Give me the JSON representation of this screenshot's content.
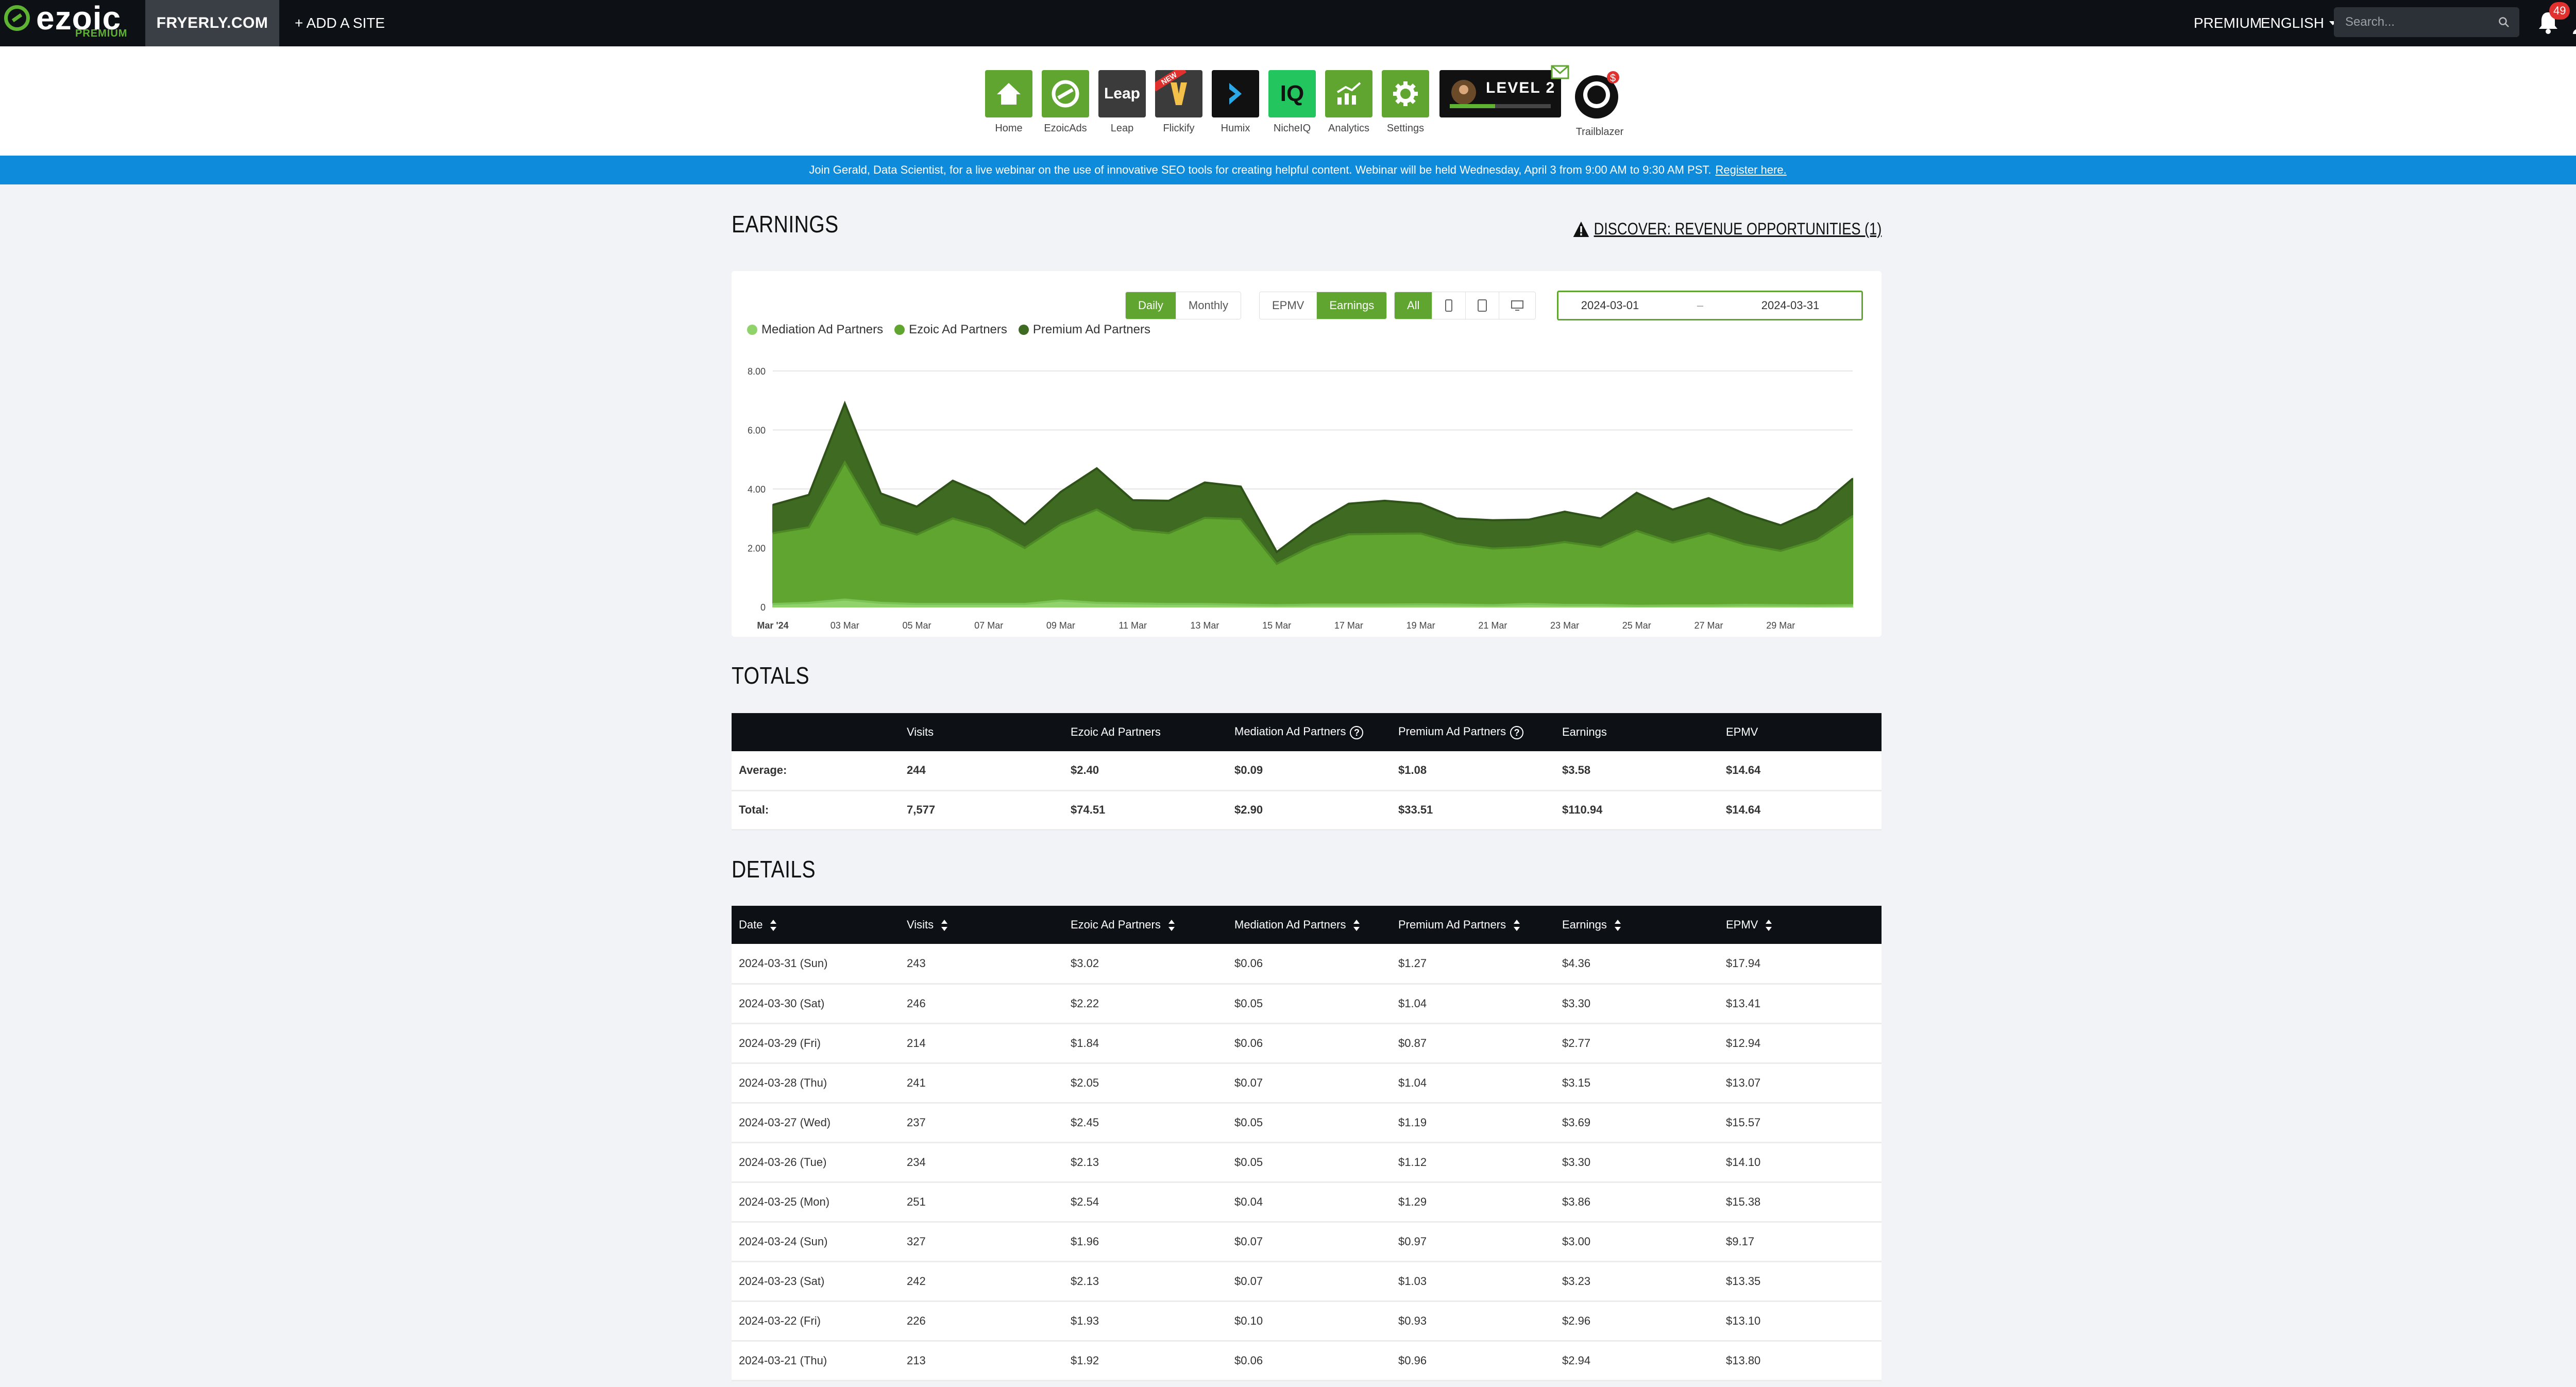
{
  "topbar": {
    "logo_word": "ezoic",
    "logo_sub": "PREMIUM",
    "site_name": "FRYERLY.COM",
    "add_site": "+ ADD A SITE",
    "premium": "PREMIUM",
    "language": "ENGLISH",
    "search_placeholder": "Search...",
    "notification_count": "49"
  },
  "apps": [
    {
      "label": "Home",
      "icon": "home-icon",
      "color": "#5fa530"
    },
    {
      "label": "EzoicAds",
      "icon": "ezoicads-icon",
      "color": "#5fa530"
    },
    {
      "label": "Leap",
      "icon": "leap-icon",
      "color": "#3b3b3b",
      "text": "Leap"
    },
    {
      "label": "Flickify",
      "icon": "flickify-icon",
      "color": "#3b3b3b",
      "badge": "NEW"
    },
    {
      "label": "Humix",
      "icon": "humix-icon",
      "color": "#111111"
    },
    {
      "label": "NicheIQ",
      "icon": "nicheiq-icon",
      "color": "#22c55e",
      "text": "IQ"
    },
    {
      "label": "Analytics",
      "icon": "analytics-icon",
      "color": "#5fa530"
    },
    {
      "label": "Settings",
      "icon": "settings-icon",
      "color": "#5fa530"
    }
  ],
  "level": {
    "text": "LEVEL 2",
    "progress": 0.45
  },
  "trailblazer": {
    "label": "Trailblazer"
  },
  "banner": {
    "text": "Join Gerald, Data Scientist, for a live webinar on the use of innovative SEO tools for creating helpful content. Webinar will be held Wednesday, April 3 from 9:00 AM to 9:30 AM PST.",
    "link": "Register here."
  },
  "earnings": {
    "title": "EARNINGS",
    "discover": "DISCOVER: REVENUE OPPORTUNITIES (1)",
    "period_buttons": [
      "Daily",
      "Monthly"
    ],
    "metric_buttons": [
      "EPMV",
      "Earnings"
    ],
    "device_all": "All",
    "date_from": "2024-03-01",
    "date_sep": "–",
    "date_to": "2024-03-31"
  },
  "colors": {
    "accent": "#5fa530",
    "mediation": "#8fd36a",
    "ezoic": "#5fa530",
    "premium": "#3e6b21",
    "topbar": "#0d1116",
    "banner": "#0f8bdb"
  },
  "chart_data": {
    "type": "area",
    "stacked": true,
    "x": [
      "2024-03-01",
      "2024-03-02",
      "2024-03-03",
      "2024-03-04",
      "2024-03-05",
      "2024-03-06",
      "2024-03-07",
      "2024-03-08",
      "2024-03-09",
      "2024-03-10",
      "2024-03-11",
      "2024-03-12",
      "2024-03-13",
      "2024-03-14",
      "2024-03-15",
      "2024-03-16",
      "2024-03-17",
      "2024-03-18",
      "2024-03-19",
      "2024-03-20",
      "2024-03-21",
      "2024-03-22",
      "2024-03-23",
      "2024-03-24",
      "2024-03-25",
      "2024-03-26",
      "2024-03-27",
      "2024-03-28",
      "2024-03-29",
      "2024-03-30",
      "2024-03-31"
    ],
    "x_tick_labels": [
      "Mar '24",
      "03 Mar",
      "05 Mar",
      "07 Mar",
      "09 Mar",
      "11 Mar",
      "13 Mar",
      "15 Mar",
      "17 Mar",
      "19 Mar",
      "21 Mar",
      "23 Mar",
      "25 Mar",
      "27 Mar",
      "29 Mar"
    ],
    "y_ticks": [
      "0",
      "2.00",
      "4.00",
      "6.00",
      "8.00"
    ],
    "ylim": [
      0,
      8
    ],
    "legend_position": "top-left",
    "series": [
      {
        "name": "Mediation Ad Partners",
        "color": "#8fd36a",
        "values": [
          0.1,
          0.14,
          0.25,
          0.14,
          0.1,
          0.1,
          0.1,
          0.1,
          0.22,
          0.14,
          0.12,
          0.1,
          0.1,
          0.08,
          0.06,
          0.08,
          0.08,
          0.08,
          0.09,
          0.08,
          0.06,
          0.1,
          0.07,
          0.07,
          0.04,
          0.05,
          0.05,
          0.07,
          0.06,
          0.05,
          0.06
        ]
      },
      {
        "name": "Ezoic Ad Partners",
        "color": "#5fa530",
        "values": [
          2.4,
          2.56,
          4.65,
          2.66,
          2.35,
          2.9,
          2.55,
          1.9,
          2.58,
          3.16,
          2.5,
          2.4,
          2.92,
          2.9,
          1.4,
          2.0,
          2.38,
          2.4,
          2.4,
          2.06,
          1.92,
          1.93,
          2.13,
          1.96,
          2.54,
          2.13,
          2.45,
          2.05,
          1.84,
          2.22,
          3.02
        ]
      },
      {
        "name": "Premium Ad Partners",
        "color": "#3e6b21",
        "values": [
          0.96,
          1.1,
          2.0,
          1.05,
          0.95,
          1.28,
          1.1,
          0.8,
          1.1,
          1.4,
          1.0,
          1.1,
          1.2,
          1.1,
          0.4,
          0.7,
          1.04,
          1.12,
          1.01,
          0.86,
          0.96,
          0.93,
          1.03,
          0.97,
          1.29,
          1.12,
          1.19,
          1.04,
          0.87,
          1.04,
          1.27
        ]
      }
    ]
  },
  "totals": {
    "title": "TOTALS",
    "headers": [
      "",
      "Visits",
      "Ezoic Ad Partners",
      "Mediation Ad Partners",
      "Premium Ad Partners",
      "Earnings",
      "EPMV"
    ],
    "rows": [
      [
        "Average:",
        "244",
        "$2.40",
        "$0.09",
        "$1.08",
        "$3.58",
        "$14.64"
      ],
      [
        "Total:",
        "7,577",
        "$74.51",
        "$2.90",
        "$33.51",
        "$110.94",
        "$14.64"
      ]
    ]
  },
  "details": {
    "title": "DETAILS",
    "headers": [
      "Date",
      "Visits",
      "Ezoic Ad Partners",
      "Mediation Ad Partners",
      "Premium Ad Partners",
      "Earnings",
      "EPMV"
    ],
    "rows": [
      [
        "2024-03-31 (Sun)",
        "243",
        "$3.02",
        "$0.06",
        "$1.27",
        "$4.36",
        "$17.94"
      ],
      [
        "2024-03-30 (Sat)",
        "246",
        "$2.22",
        "$0.05",
        "$1.04",
        "$3.30",
        "$13.41"
      ],
      [
        "2024-03-29 (Fri)",
        "214",
        "$1.84",
        "$0.06",
        "$0.87",
        "$2.77",
        "$12.94"
      ],
      [
        "2024-03-28 (Thu)",
        "241",
        "$2.05",
        "$0.07",
        "$1.04",
        "$3.15",
        "$13.07"
      ],
      [
        "2024-03-27 (Wed)",
        "237",
        "$2.45",
        "$0.05",
        "$1.19",
        "$3.69",
        "$15.57"
      ],
      [
        "2024-03-26 (Tue)",
        "234",
        "$2.13",
        "$0.05",
        "$1.12",
        "$3.30",
        "$14.10"
      ],
      [
        "2024-03-25 (Mon)",
        "251",
        "$2.54",
        "$0.04",
        "$1.29",
        "$3.86",
        "$15.38"
      ],
      [
        "2024-03-24 (Sun)",
        "327",
        "$1.96",
        "$0.07",
        "$0.97",
        "$3.00",
        "$9.17"
      ],
      [
        "2024-03-23 (Sat)",
        "242",
        "$2.13",
        "$0.07",
        "$1.03",
        "$3.23",
        "$13.35"
      ],
      [
        "2024-03-22 (Fri)",
        "226",
        "$1.93",
        "$0.10",
        "$0.93",
        "$2.96",
        "$13.10"
      ],
      [
        "2024-03-21 (Thu)",
        "213",
        "$1.92",
        "$0.06",
        "$0.96",
        "$2.94",
        "$13.80"
      ]
    ]
  }
}
